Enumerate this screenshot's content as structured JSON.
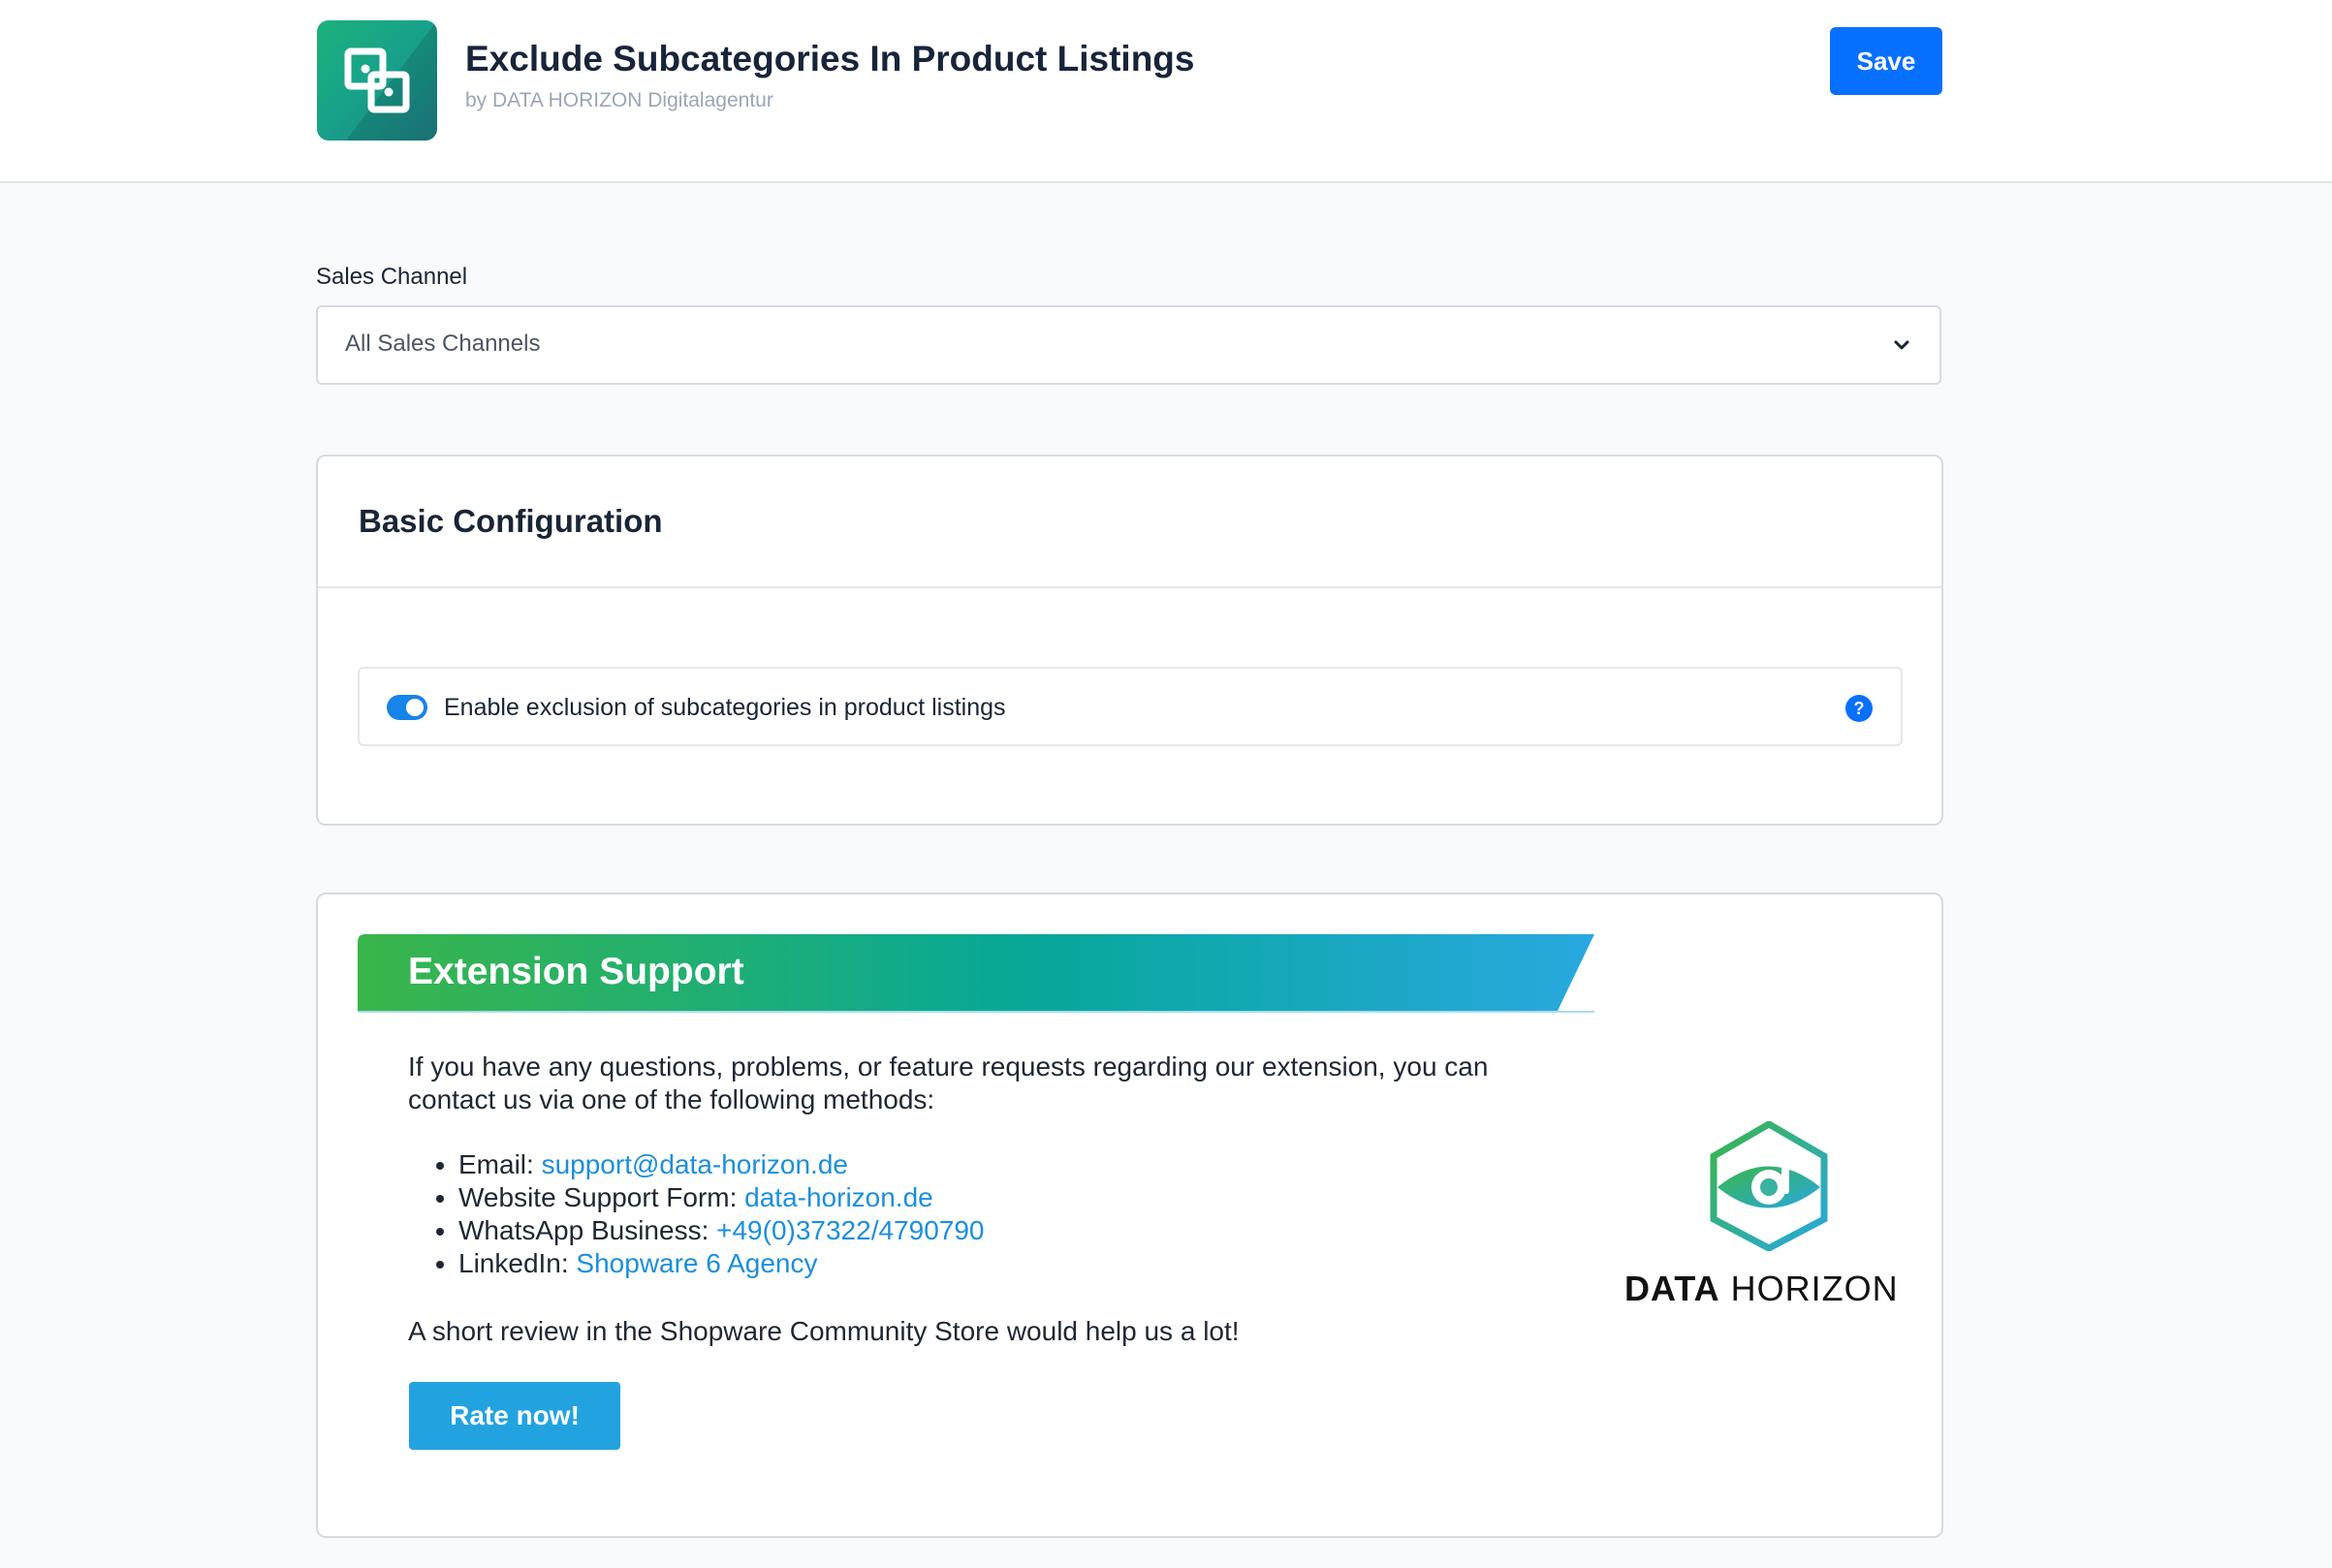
{
  "header": {
    "title": "Exclude Subcategories In Product Listings",
    "author": "by DATA HORIZON Digitalagentur",
    "save_label": "Save"
  },
  "sales_channel": {
    "label": "Sales Channel",
    "value": "All Sales Channels"
  },
  "basic_config": {
    "title": "Basic Configuration",
    "toggle_label": "Enable exclusion of subcategories in product listings",
    "toggle_on": true,
    "help_label": "?"
  },
  "support": {
    "title": "Extension Support",
    "intro": "If you have any questions, problems, or feature requests regarding our extension, you can contact us via one of the following methods:",
    "email_label": "Email:",
    "email_value": "support@data-horizon.de",
    "form_label": "Website Support Form:",
    "form_value": "data-horizon.de",
    "whatsapp_label": "WhatsApp Business:",
    "whatsapp_value": "+49(0)37322/4790790",
    "linkedin_label": "LinkedIn:",
    "linkedin_value": "Shopware 6 Agency",
    "review_text": "A short review in the Shopware Community Store would help us a lot!",
    "rate_label": "Rate now!",
    "brand_bold": "DATA",
    "brand_regular": "HORIZON"
  },
  "colors": {
    "primary": "#0870ff",
    "link": "#1b8fdc",
    "rate_button": "#22a3e0",
    "banner_start": "#3ab54a",
    "banner_end": "#29a8e0"
  }
}
